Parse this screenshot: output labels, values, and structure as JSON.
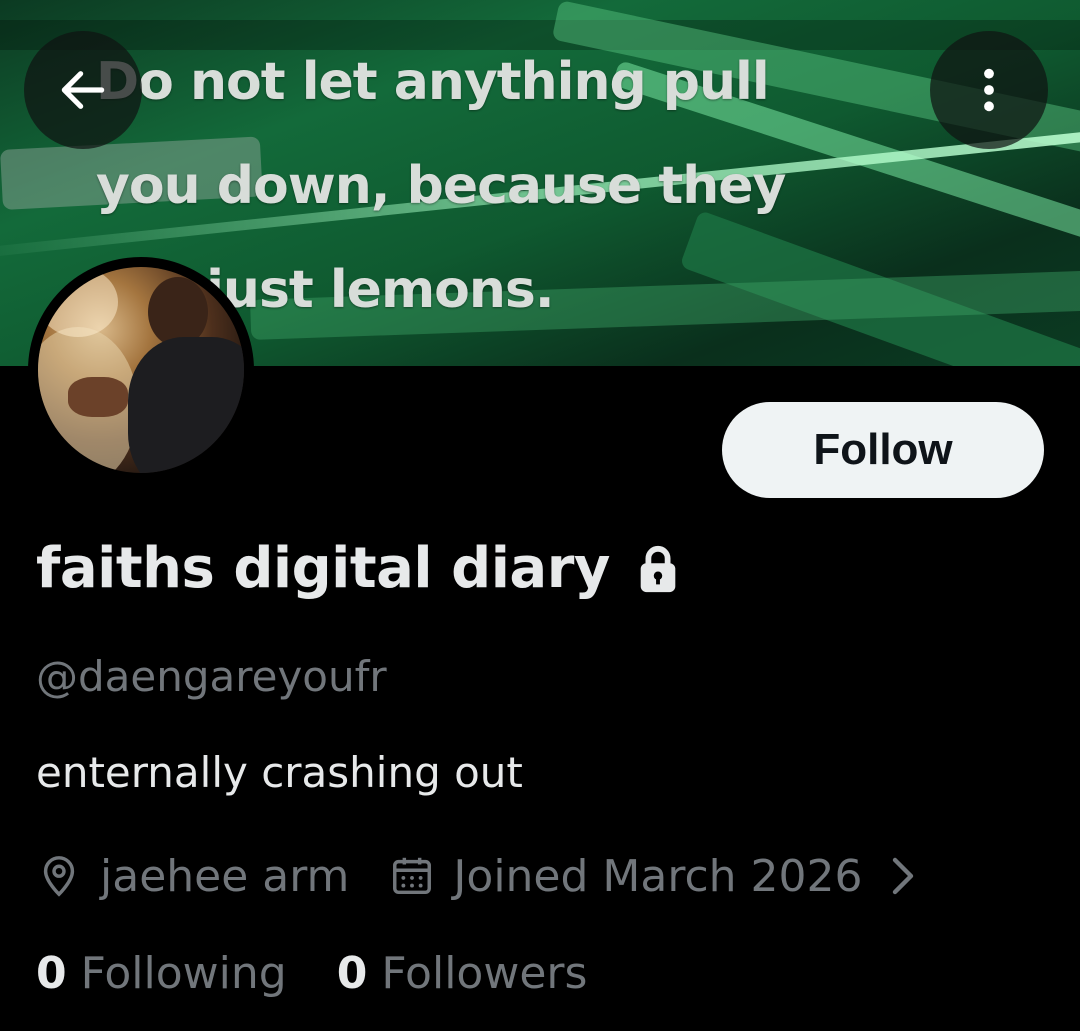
{
  "banner": {
    "quote_lines": [
      "Do not let anything pull",
      "you down, because they",
      "are just lemons."
    ]
  },
  "header": {
    "back_icon": "arrow-left-icon",
    "more_icon": "more-vertical-icon"
  },
  "profile": {
    "display_name": "faiths digital diary",
    "protected_icon": "lock-icon",
    "handle": "@daengareyoufr",
    "bio": "enternally crashing out",
    "location": "jaehee arm",
    "joined": "Joined March 2026",
    "following_count": "0",
    "following_label": "Following",
    "followers_count": "0",
    "followers_label": "Followers"
  },
  "actions": {
    "follow_label": "Follow"
  },
  "colors": {
    "background": "#000000",
    "primary_text": "#e7e9ea",
    "secondary_text": "#71767b",
    "follow_button_bg": "#eff3f4",
    "follow_button_text": "#0f1419",
    "banner_green": "#136a3a"
  }
}
